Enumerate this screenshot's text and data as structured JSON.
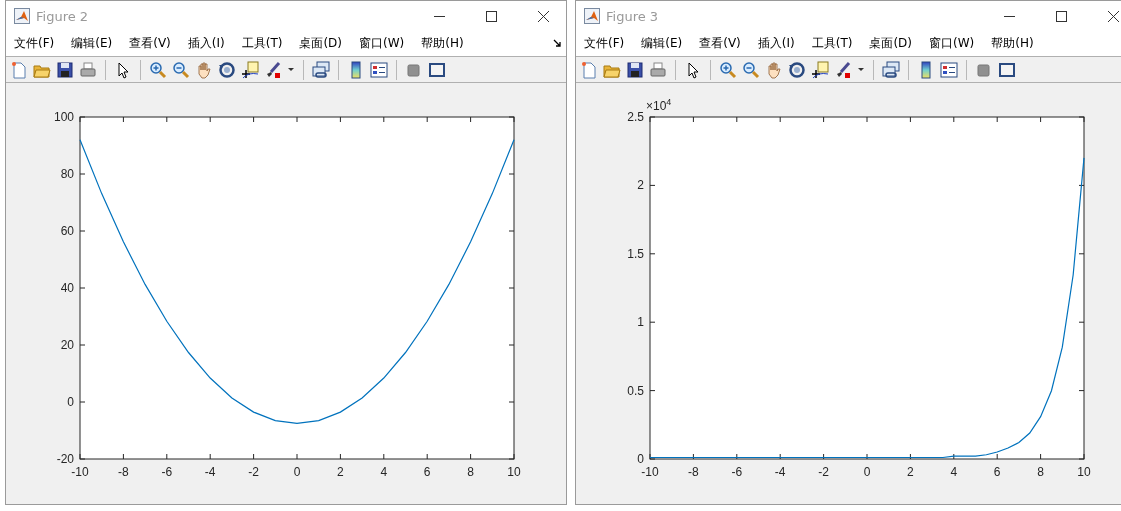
{
  "windows": [
    {
      "title": "Figure 2",
      "dock_arrow": true,
      "menu": [
        "文件(F)",
        "编辑(E)",
        "查看(V)",
        "插入(I)",
        "工具(T)",
        "桌面(D)",
        "窗口(W)",
        "帮助(H)"
      ],
      "chart_data": {
        "type": "line",
        "x": [
          -10,
          -9,
          -8,
          -7,
          -6,
          -5,
          -4,
          -3,
          -2,
          -1,
          0,
          1,
          2,
          3,
          4,
          5,
          6,
          7,
          8,
          9,
          10
        ],
        "series": [
          {
            "color": "#0072bd",
            "values": [
              92,
              73,
              56,
              41,
              28,
              17,
              8,
              1,
              -4,
              -7,
              -8,
              -7,
              -4,
              1,
              8,
              17,
              28,
              41,
              56,
              73,
              92
            ]
          }
        ],
        "xlim": [
          -10,
          10
        ],
        "ylim": [
          -20,
          100
        ],
        "xticks": [
          -10,
          -8,
          -6,
          -4,
          -2,
          0,
          2,
          4,
          6,
          8,
          10
        ],
        "yticks": [
          -20,
          0,
          20,
          40,
          60,
          80,
          100
        ]
      }
    },
    {
      "title": "Figure 3",
      "dock_arrow": false,
      "menu": [
        "文件(F)",
        "编辑(E)",
        "查看(V)",
        "插入(I)",
        "工具(T)",
        "桌面(D)",
        "窗口(W)",
        "帮助(H)"
      ],
      "y_exponent_label": "×10$^{4}$",
      "chart_data": {
        "type": "line",
        "x": [
          -10,
          -9.5,
          -9,
          -8.5,
          -8,
          -7.5,
          -7,
          -6.5,
          -6,
          -5.5,
          -5,
          -4.5,
          -4,
          -3.5,
          -3,
          -2.5,
          -2,
          -1.5,
          -1,
          -0.5,
          0,
          0.5,
          1,
          1.5,
          2,
          2.5,
          3,
          3.5,
          4,
          4.5,
          5,
          5.5,
          6,
          6.5,
          7,
          7.5,
          8,
          8.5,
          9,
          9.5,
          10
        ],
        "series": [
          {
            "color": "#0072bd",
            "values": [
              0,
              0,
              0,
              0,
              0,
              0,
              0,
              0,
              0,
              0,
              0,
              0,
              0,
              0,
              0,
              0,
              0,
              0,
              0,
              0,
              0,
              0,
              0,
              0,
              0,
              0,
              0,
              0,
              0.01,
              0.01,
              0.01,
              0.02,
              0.04,
              0.07,
              0.11,
              0.18,
              0.3,
              0.49,
              0.81,
              1.34,
              2.2
            ]
          }
        ],
        "xlim": [
          -10,
          10
        ],
        "ylim": [
          0,
          2.5
        ],
        "xticks": [
          -10,
          -8,
          -6,
          -4,
          -2,
          0,
          2,
          4,
          6,
          8,
          10
        ],
        "yticks": [
          0,
          0.5,
          1,
          1.5,
          2,
          2.5
        ]
      }
    }
  ]
}
